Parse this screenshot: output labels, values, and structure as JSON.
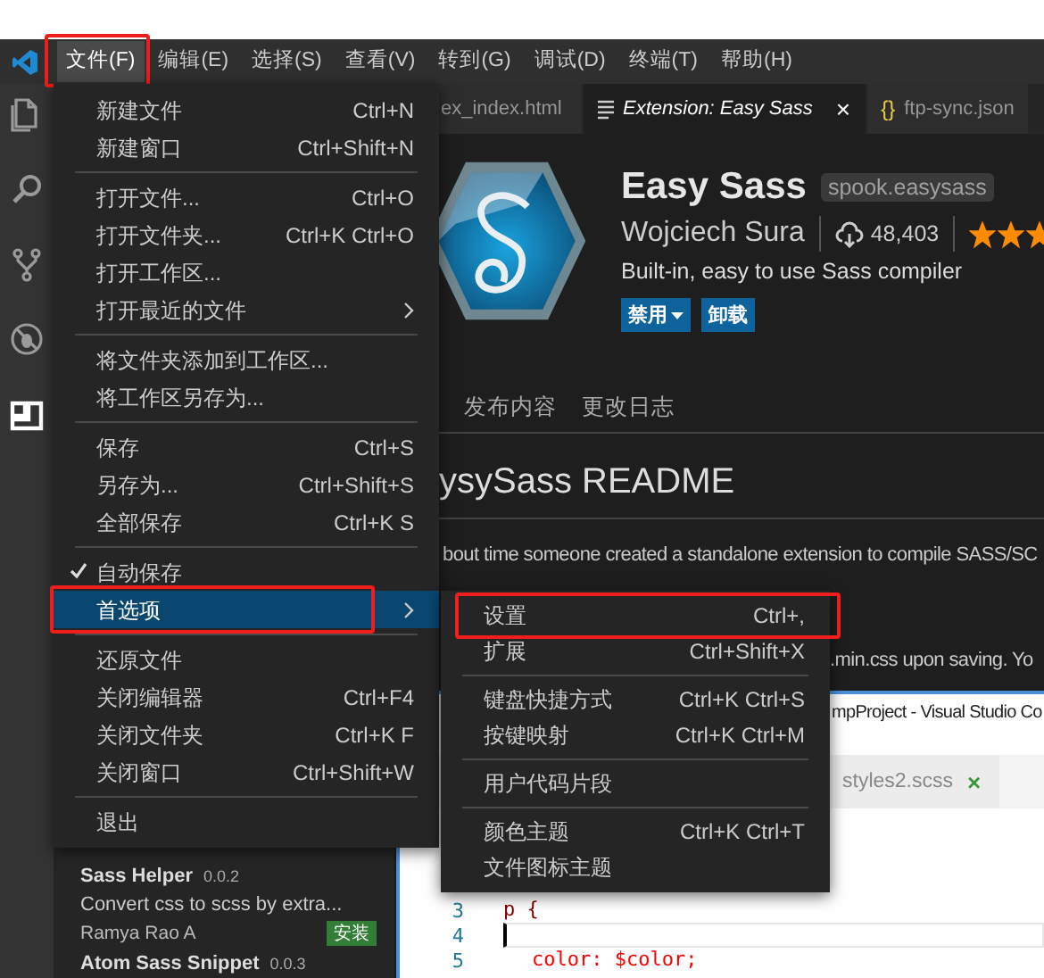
{
  "menubar": {
    "items": [
      {
        "label": "文件(F)",
        "selected": true,
        "annotated": true
      },
      {
        "label": "编辑(E)",
        "selected": false,
        "annotated": false
      },
      {
        "label": "选择(S)",
        "selected": false,
        "annotated": false
      },
      {
        "label": "查看(V)",
        "selected": false,
        "annotated": false
      },
      {
        "label": "转到(G)",
        "selected": false,
        "annotated": false
      },
      {
        "label": "调试(D)",
        "selected": false,
        "annotated": false
      },
      {
        "label": "终端(T)",
        "selected": false,
        "annotated": false
      },
      {
        "label": "帮助(H)",
        "selected": false,
        "annotated": false
      }
    ]
  },
  "activity_bar": {
    "items": [
      {
        "kind": "files",
        "selected": false
      },
      {
        "kind": "search",
        "selected": false
      },
      {
        "kind": "source-control",
        "selected": false
      },
      {
        "kind": "debug",
        "selected": false
      },
      {
        "kind": "extensions",
        "selected": true
      }
    ]
  },
  "editor_tabs": [
    {
      "label": "ex_index.html",
      "kind": "html",
      "selected": false
    },
    {
      "label": "Extension: Easy Sass",
      "kind": "extension",
      "selected": true,
      "close": "×"
    },
    {
      "label": "ftp-sync.json",
      "kind": "json",
      "selected": false,
      "icon": "{}"
    }
  ],
  "extension": {
    "name": "Easy Sass",
    "id": "spook.easysass",
    "publisher": "Wojciech Sura",
    "installs": "48,403",
    "stars": 3,
    "description": "Built-in, easy to use Sass compiler",
    "buttons": [
      {
        "label": "禁用",
        "dropdown": true
      },
      {
        "label": "卸载",
        "dropdown": false
      }
    ],
    "tabs": [
      {
        "label": "发布内容",
        "selected": false
      },
      {
        "label": "更改日志",
        "selected": false
      }
    ],
    "readme_title": "ysySass README",
    "readme_lines": [
      "bout time someone created a standalone extension to compile SASS/SC",
      ".min.css upon saving. Yo"
    ]
  },
  "sidebar": {
    "extensions": [
      {
        "name": "Sass Helper",
        "version": "0.0.2",
        "description": "Convert css to scss by extra...",
        "publisher": "Ramya Rao A",
        "action": "安装"
      },
      {
        "name": "Atom Sass Snippet",
        "version": "0.0.3"
      }
    ]
  },
  "inner_window": {
    "title": "mpProject - Visual Studio Co",
    "tabs": [
      {
        "label": "styles2.scss",
        "close": "×"
      }
    ],
    "lines": [
      {
        "number": "3",
        "kind": "selector",
        "code": "p {"
      },
      {
        "number": "4",
        "kind": "cursor"
      },
      {
        "number": "5",
        "kind": "declaration",
        "property": "color:",
        "value": "$color;"
      }
    ]
  },
  "file_menu": {
    "items": [
      {
        "kind": "command",
        "label": "新建文件",
        "shortcut": "Ctrl+N",
        "selected": false,
        "annotated": false
      },
      {
        "kind": "command",
        "label": "新建窗口",
        "shortcut": "Ctrl+Shift+N",
        "selected": false,
        "annotated": false
      },
      {
        "kind": "separator"
      },
      {
        "kind": "command",
        "label": "打开文件...",
        "shortcut": "Ctrl+O",
        "selected": false,
        "annotated": false
      },
      {
        "kind": "command",
        "label": "打开文件夹...",
        "shortcut": "Ctrl+K Ctrl+O",
        "selected": false,
        "annotated": false
      },
      {
        "kind": "command",
        "label": "打开工作区...",
        "selected": false,
        "annotated": false
      },
      {
        "kind": "submenu",
        "label": "打开最近的文件",
        "selected": false,
        "annotated": false
      },
      {
        "kind": "separator"
      },
      {
        "kind": "command",
        "label": "将文件夹添加到工作区...",
        "selected": false,
        "annotated": false
      },
      {
        "kind": "command",
        "label": "将工作区另存为...",
        "selected": false,
        "annotated": false
      },
      {
        "kind": "separator"
      },
      {
        "kind": "command",
        "label": "保存",
        "shortcut": "Ctrl+S",
        "selected": false,
        "annotated": false
      },
      {
        "kind": "command",
        "label": "另存为...",
        "shortcut": "Ctrl+Shift+S",
        "selected": false,
        "annotated": false
      },
      {
        "kind": "command",
        "label": "全部保存",
        "shortcut": "Ctrl+K S",
        "selected": false,
        "annotated": false
      },
      {
        "kind": "separator"
      },
      {
        "kind": "check",
        "label": "自动保存",
        "checked": true,
        "selected": false,
        "annotated": false
      },
      {
        "kind": "submenu",
        "label": "首选项",
        "selected": true,
        "annotated": true
      },
      {
        "kind": "separator"
      },
      {
        "kind": "command",
        "label": "还原文件",
        "selected": false,
        "annotated": false
      },
      {
        "kind": "command",
        "label": "关闭编辑器",
        "shortcut": "Ctrl+F4",
        "selected": false,
        "annotated": false
      },
      {
        "kind": "command",
        "label": "关闭文件夹",
        "shortcut": "Ctrl+K F",
        "selected": false,
        "annotated": false
      },
      {
        "kind": "command",
        "label": "关闭窗口",
        "shortcut": "Ctrl+Shift+W",
        "selected": false,
        "annotated": false
      },
      {
        "kind": "separator"
      },
      {
        "kind": "command",
        "label": "退出",
        "selected": false,
        "annotated": false
      }
    ]
  },
  "preferences_menu": {
    "items": [
      {
        "kind": "command",
        "label": "设置",
        "shortcut": "Ctrl+,",
        "selected": false,
        "annotated": true
      },
      {
        "kind": "command",
        "label": "扩展",
        "shortcut": "Ctrl+Shift+X",
        "selected": false,
        "annotated": false
      },
      {
        "kind": "separator"
      },
      {
        "kind": "command",
        "label": "键盘快捷方式",
        "shortcut": "Ctrl+K Ctrl+S",
        "selected": false,
        "annotated": false
      },
      {
        "kind": "command",
        "label": "按键映射",
        "shortcut": "Ctrl+K Ctrl+M",
        "selected": false,
        "annotated": false
      },
      {
        "kind": "separator"
      },
      {
        "kind": "command",
        "label": "用户代码片段",
        "selected": false,
        "annotated": false
      },
      {
        "kind": "separator"
      },
      {
        "kind": "command",
        "label": "颜色主题",
        "shortcut": "Ctrl+K Ctrl+T",
        "selected": false,
        "annotated": false
      },
      {
        "kind": "command",
        "label": "文件图标主题",
        "selected": false,
        "annotated": false
      }
    ]
  }
}
